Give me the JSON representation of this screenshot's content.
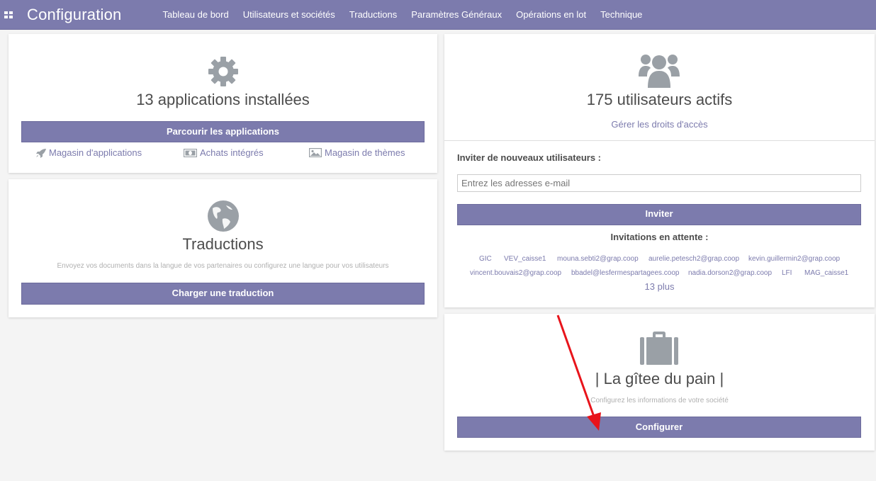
{
  "navbar": {
    "brand": "Configuration",
    "menu": [
      {
        "label": "Tableau de bord"
      },
      {
        "label": "Utilisateurs et sociétés"
      },
      {
        "label": "Traductions"
      },
      {
        "label": "Paramètres Généraux"
      },
      {
        "label": "Opérations en lot"
      },
      {
        "label": "Technique"
      }
    ]
  },
  "apps": {
    "icon": "gear-icon",
    "title": "13 applications installées",
    "browse_button": "Parcourir les applications",
    "links": [
      {
        "label": "Magasin d'applications",
        "icon": "rocket-icon"
      },
      {
        "label": "Achats intégrés",
        "icon": "money-icon"
      },
      {
        "label": "Magasin de thèmes",
        "icon": "picture-icon"
      }
    ]
  },
  "translations": {
    "icon": "globe-icon",
    "title": "Traductions",
    "description": "Envoyez vos documents dans la langue de vos partenaires ou configurez une langue pour vos utilisateurs",
    "load_button": "Charger une traduction"
  },
  "users": {
    "icon": "users-icon",
    "title": "175 utilisateurs actifs",
    "manage_link": "Gérer les droits d'accès",
    "invite_label": "Inviter de nouveaux utilisateurs :",
    "email_placeholder": "Entrez les adresses e-mail",
    "invite_button": "Inviter",
    "pending_title": "Invitations en attente :",
    "pending": [
      "GIC",
      "VEV_caisse1",
      "mouna.sebti2@grap.coop",
      "aurelie.petesch2@grap.coop",
      "kevin.guillermin2@grap.coop",
      "vincent.bouvais2@grap.coop",
      "bbadel@lesfermespartagees.coop",
      "nadia.dorson2@grap.coop",
      "LFI",
      "MAG_caisse1"
    ],
    "more": "13 plus"
  },
  "company": {
    "icon": "briefcase-icon",
    "title": "| La gîtee du pain |",
    "description": "Configurez les informations de votre société",
    "configure_button": "Configurer"
  },
  "colors": {
    "primary": "#7c7bad",
    "arrow": "#e8141b"
  }
}
